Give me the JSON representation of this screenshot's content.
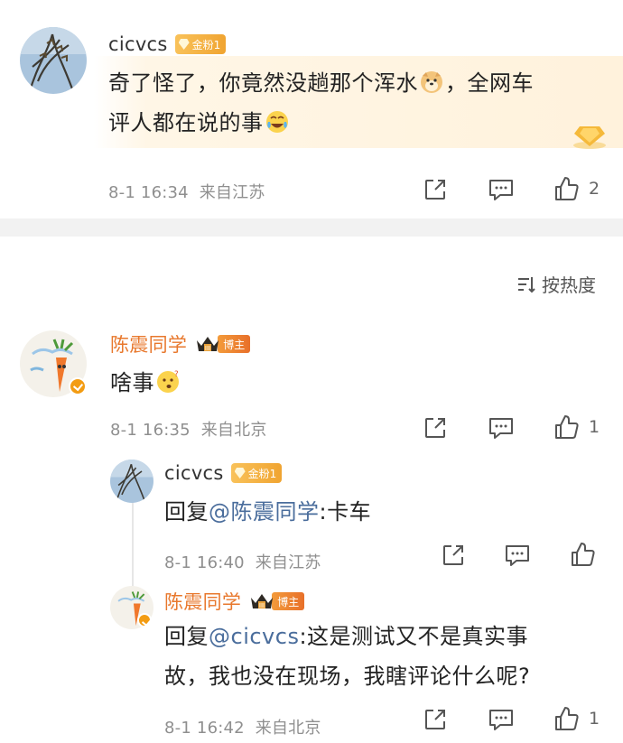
{
  "top_comment": {
    "username": "cicvcs",
    "fan_badge": "金粉1",
    "text_parts": [
      "奇了怪了，你竟然没趟那个浑水",
      "，全网车",
      "评人都在说的事"
    ],
    "time": "8-1 16:34",
    "location": "来自江苏",
    "like_count": "2"
  },
  "sort": {
    "label": "按热度"
  },
  "main_comment": {
    "username": "陈震同学",
    "badge_label": "博主",
    "text": "啥事",
    "time": "8-1 16:35",
    "location": "来自北京",
    "like_count": "1"
  },
  "reply1": {
    "username": "cicvcs",
    "fan_badge": "金粉1",
    "prefix": "回复",
    "mention": "@陈震同学",
    "text": ":卡车",
    "time": "8-1 16:40",
    "location": "来自江苏"
  },
  "reply2": {
    "username": "陈震同学",
    "badge_label": "博主",
    "prefix": "回复",
    "mention": "@cicvcs",
    "text_line1": ":这是测试又不是真实事",
    "text_line2": "故，我也没在现场，我瞎评论什么呢?",
    "time": "8-1 16:42",
    "location": "来自北京",
    "like_count": "1"
  },
  "icons": {
    "share": "share-icon",
    "comment": "comment-icon",
    "like": "thumbs-up-icon",
    "sort": "sort-icon"
  },
  "colors": {
    "accent_orange": "#e8782d",
    "mention_blue": "#4a6d9c",
    "meta_gray": "#8f8f8f"
  }
}
